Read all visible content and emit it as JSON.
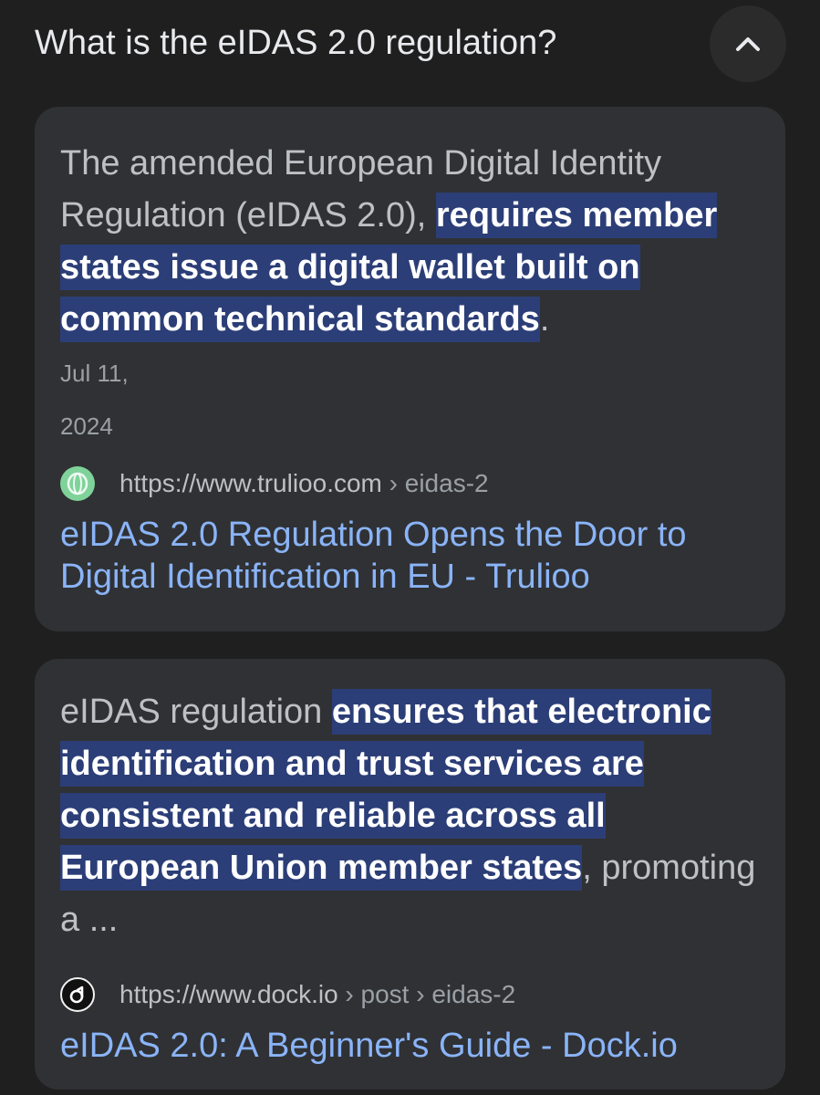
{
  "header": {
    "question": "What is the eIDAS 2.0 regulation?",
    "collapse_icon": "chevron-up-icon"
  },
  "results": [
    {
      "snippet_pre": "The amended European Digital Identity Regulation (eIDAS 2.0), ",
      "snippet_highlight": "requires member states issue a digital wallet built on common technical standards",
      "snippet_post": ".",
      "date_line1": "Jul 11,",
      "date_line2": "2024",
      "favicon": "trulioo-favicon",
      "url_domain": "https://www.trulioo.com",
      "url_path": " › eidas-2",
      "title": "eIDAS 2.0 Regulation Opens the Door to Digital Identification in EU - Trulioo"
    },
    {
      "snippet_pre": "eIDAS regulation ",
      "snippet_highlight": "ensures that electronic identification and trust services are consistent and reliable across all European Union member states",
      "snippet_post": ", promoting a ...",
      "favicon": "dock-favicon",
      "url_domain": "https://www.dock.io",
      "url_path": " › post › eidas-2",
      "title": "eIDAS 2.0: A Beginner's Guide - Dock.io"
    }
  ],
  "colors": {
    "background": "#1f1f1f",
    "card": "#303134",
    "highlight": "#2c3e77",
    "link": "#8ab4f8"
  }
}
